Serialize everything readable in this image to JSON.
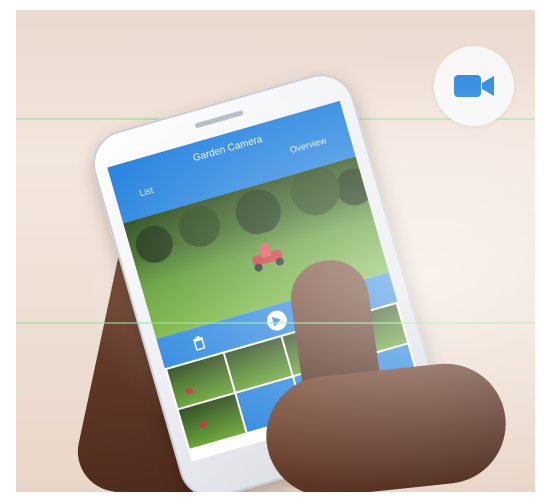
{
  "app": {
    "title": "Garden Camera",
    "tabs": [
      "List",
      "Overview"
    ]
  },
  "badge": {
    "icon": "video-camera-icon"
  },
  "toolbar": {
    "icons": [
      "trash-icon",
      "play-icon",
      "gallery-icon"
    ]
  },
  "thumbnails": {
    "filled": 5,
    "empty": 3
  },
  "colors": {
    "accent": "#2c87e0",
    "badge_bg": "#f7f7f7"
  }
}
